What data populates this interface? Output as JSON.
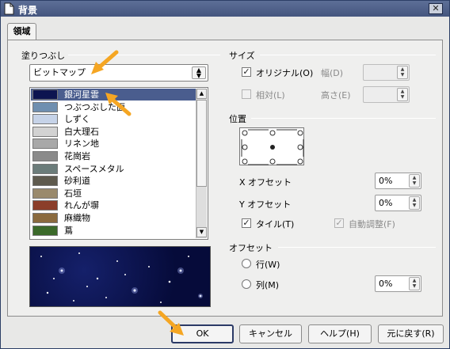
{
  "window": {
    "title": "背景",
    "close_symbol": "✕"
  },
  "tabs": [
    {
      "label": "領域"
    }
  ],
  "fill": {
    "group_label": "塗りつぶし",
    "type_selected": "ビットマップ",
    "bitmaps": [
      {
        "label": "銀河星雲",
        "selected": true,
        "swatch": "#0d1450"
      },
      {
        "label": "つぶつぶした面",
        "swatch": "#6f8fb0"
      },
      {
        "label": "しずく",
        "swatch": "#c6d3e8"
      },
      {
        "label": "白大理石",
        "swatch": "#d2d2d2"
      },
      {
        "label": "リネン地",
        "swatch": "#a8a8a8"
      },
      {
        "label": "花崗岩",
        "swatch": "#8a8a8a"
      },
      {
        "label": "スペースメタル",
        "swatch": "#6b7c7a"
      },
      {
        "label": "砂利道",
        "swatch": "#5e5a4e"
      },
      {
        "label": "石垣",
        "swatch": "#9a8a6c"
      },
      {
        "label": "れんが塀",
        "swatch": "#8b3e2a"
      },
      {
        "label": "麻織物",
        "swatch": "#8a6a3e"
      },
      {
        "label": "蔦",
        "swatch": "#3b6a2a"
      }
    ]
  },
  "size": {
    "group_label": "サイズ",
    "original_label": "オリジナル(O)",
    "original_checked": true,
    "width_label": "幅(D)",
    "relative_label": "相対(L)",
    "relative_checked": false,
    "height_label": "高さ(E)"
  },
  "position": {
    "group_label": "位置",
    "x_offset_label": "X オフセット",
    "x_offset_value": "0%",
    "y_offset_label": "Y オフセット",
    "y_offset_value": "0%",
    "tile_label": "タイル(T)",
    "tile_checked": true,
    "autofit_label": "自動調整(F)",
    "autofit_checked": true
  },
  "offset": {
    "group_label": "オフセット",
    "row_label": "行(W)",
    "column_label": "列(M)",
    "value": "0%"
  },
  "buttons": {
    "ok": "OK",
    "cancel": "キャンセル",
    "help": "ヘルプ(H)",
    "reset": "元に戻す(R)"
  },
  "colors": {
    "titlebar": "#4a5b85",
    "selection": "#4a5d8e",
    "annotation_arrow": "#f5a623"
  }
}
